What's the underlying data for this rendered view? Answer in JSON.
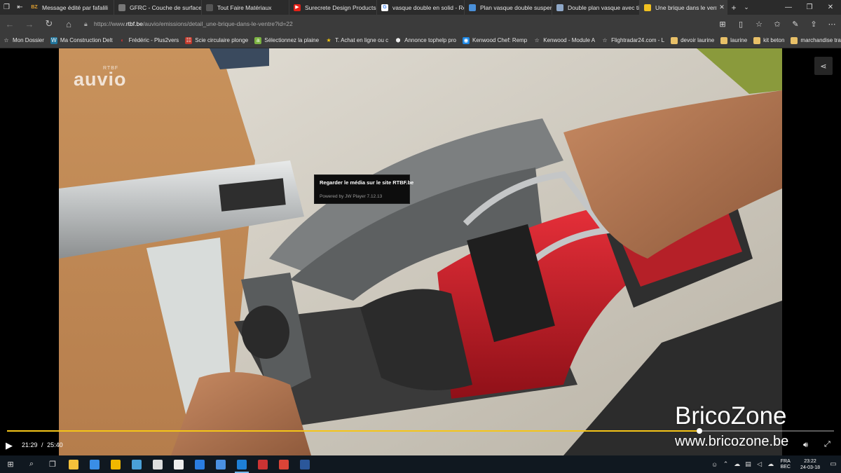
{
  "tabs": [
    {
      "title": "Message édité par fafalili",
      "favicon_text": "BZ",
      "favicon_color": "#2b2b2b",
      "favicon_fg": "#e0a030"
    },
    {
      "title": "GFRC - Couche de surface p",
      "favicon_text": "",
      "favicon_color": "#777777",
      "favicon_fg": "#ffffff"
    },
    {
      "title": "Tout Faire Matériaux",
      "favicon_text": "",
      "favicon_color": "#555555",
      "favicon_fg": "#ffffff"
    },
    {
      "title": "Surecrete Design Products -",
      "favicon_text": "▶",
      "favicon_color": "#e62117",
      "favicon_fg": "#ffffff"
    },
    {
      "title": "vasque double en solid - Re",
      "favicon_text": "G",
      "favicon_color": "#ffffff",
      "favicon_fg": "#4285f4"
    },
    {
      "title": "Plan vasque double suspen",
      "favicon_text": "",
      "favicon_color": "#4a90d9",
      "favicon_fg": "#ffffff"
    },
    {
      "title": "Double plan vasque avec tir",
      "favicon_text": "",
      "favicon_color": "#8fa8c8",
      "favicon_fg": "#ffffff"
    },
    {
      "title": "Une brique dans le vent",
      "favicon_text": "",
      "favicon_color": "#f0c020",
      "favicon_fg": "#ffffff",
      "active": true
    }
  ],
  "address": {
    "prefix": "https://www.",
    "host": "rtbf.be",
    "path": "/auvio/emissions/detail_une-brique-dans-le-ventre?id=22"
  },
  "favorites": [
    {
      "label": "Mon Dossier",
      "icon": "☆",
      "color": "transparent",
      "fg": "#dddddd"
    },
    {
      "label": "Ma Construction Delt",
      "icon": "W",
      "color": "#21759b",
      "fg": "#ffffff"
    },
    {
      "label": "Frédéric - Plus2vers",
      "icon": "◐",
      "color": "transparent",
      "fg": "#cc3333"
    },
    {
      "label": "Scie circulaire plonge",
      "icon": "☷",
      "color": "#c0392b",
      "fg": "#ffffff"
    },
    {
      "label": "Sélectionnez la plaine",
      "icon": "a",
      "color": "#7cb342",
      "fg": "#ffffff"
    },
    {
      "label": "T. Achat en ligne ou c",
      "icon": "★",
      "color": "transparent",
      "fg": "#f1c40f"
    },
    {
      "label": "Annonce tophelp pro",
      "icon": "⬢",
      "color": "transparent",
      "fg": "#eeeeee"
    },
    {
      "label": "Kenwood Chef: Remp",
      "icon": "◉",
      "color": "#1e88e5",
      "fg": "#ffffff"
    },
    {
      "label": "Kenwood - Module A",
      "icon": "☆",
      "color": "transparent",
      "fg": "#dddddd"
    },
    {
      "label": "Flightradar24.com - L",
      "icon": "☆",
      "color": "transparent",
      "fg": "#dddddd"
    },
    {
      "label": "devoir laurine",
      "icon": "",
      "color": "#e8c068",
      "fg": "#ffffff"
    },
    {
      "label": "laurine",
      "icon": "",
      "color": "#e8c068",
      "fg": "#ffffff"
    },
    {
      "label": "kit beton",
      "icon": "",
      "color": "#e8c068",
      "fg": "#ffffff"
    },
    {
      "label": "marchandise travaux",
      "icon": "",
      "color": "#e8c068",
      "fg": "#ffffff"
    }
  ],
  "player": {
    "logo_small": "RTBF",
    "logo_big": "auvio",
    "context_menu": {
      "item": "Regarder le média sur le site RTBF.be",
      "powered": "Powered by JW Player 7.12.13"
    },
    "current_time": "21:29",
    "separator": "/",
    "duration": "25:40",
    "progress": 0.837,
    "accent": "#f5c518"
  },
  "watermark": {
    "title": "BricoZone",
    "url": "www.bricozone.be"
  },
  "taskbar": {
    "apps": [
      {
        "name": "file-explorer",
        "color": "#f5c13b"
      },
      {
        "name": "store",
        "color": "#3a8ee6"
      },
      {
        "name": "app-yellow",
        "color": "#f0b800"
      },
      {
        "name": "app-network",
        "color": "#4aa0d8"
      },
      {
        "name": "app-user",
        "color": "#dddddd"
      },
      {
        "name": "app-notes",
        "color": "#eeeeee"
      },
      {
        "name": "app-calc",
        "color": "#2a7de1"
      },
      {
        "name": "app-at",
        "color": "#4a90e2"
      },
      {
        "name": "edge",
        "color": "#1e7fd6",
        "active": true
      },
      {
        "name": "app-game",
        "color": "#cc3333"
      },
      {
        "name": "chrome",
        "color": "#db4437"
      },
      {
        "name": "word",
        "color": "#2b579a"
      }
    ],
    "lang": "FRA",
    "lang2": "BEC",
    "time": "23:22",
    "date": "24-03-18"
  }
}
